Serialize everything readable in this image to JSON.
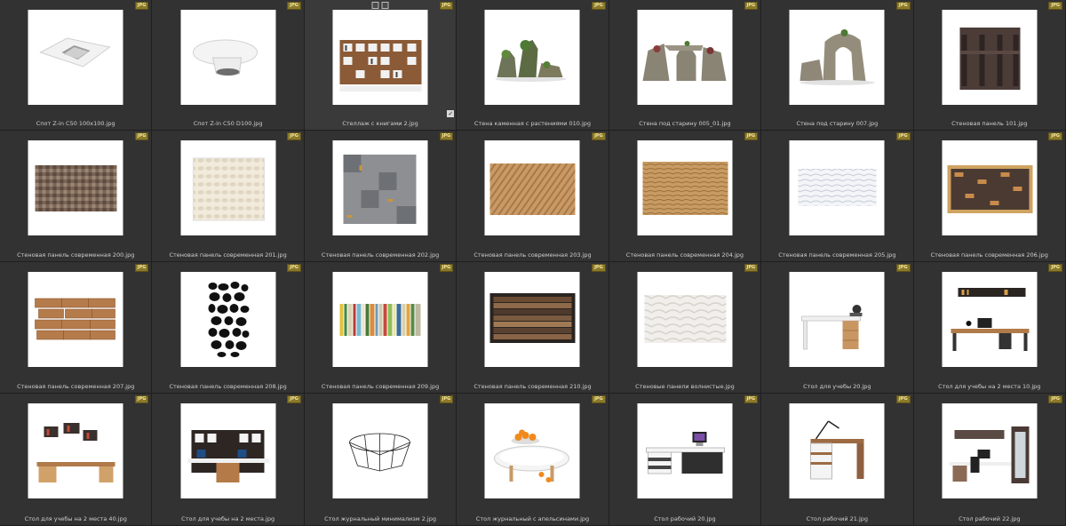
{
  "badge": "JPG",
  "items": [
    {
      "label": "Спот Z-in C50 100x100.jpg",
      "icon": "square-ceiling-spot-thumbnail"
    },
    {
      "label": "Спот Z-in C50 D100.jpg",
      "icon": "round-ceiling-spot-thumbnail"
    },
    {
      "label": "Стеллаж с книгами 2.jpg",
      "icon": "bookshelf-thumbnail"
    },
    {
      "label": "Стена каменная с растениями 010.jpg",
      "icon": "stone-wall-plants-thumbnail"
    },
    {
      "label": "Стена под старину 005_01.jpg",
      "icon": "ruin-arch-thumbnail"
    },
    {
      "label": "Стена под старину 007.jpg",
      "icon": "ruin-arch-thumbnail"
    },
    {
      "label": "Стеновая панель 101.jpg",
      "icon": "dark-wall-panel-thumbnail"
    },
    {
      "label": "Стеновая панель современная 200.jpg",
      "icon": "mosaic-panel-thumbnail"
    },
    {
      "label": "Стеновая панель современная 201.jpg",
      "icon": "white-relief-panel-thumbnail"
    },
    {
      "label": "Стеновая панель современная 202.jpg",
      "icon": "gray-tile-panel-thumbnail"
    },
    {
      "label": "Стеновая панель современная 203.jpg",
      "icon": "wood-diagonal-panel-thumbnail"
    },
    {
      "label": "Стеновая панель современная 204.jpg",
      "icon": "wood-wave-panel-thumbnail"
    },
    {
      "label": "Стеновая панель современная 205.jpg",
      "icon": "white-wave-panel-thumbnail"
    },
    {
      "label": "Стеновая панель современная 206.jpg",
      "icon": "brick-block-panel-thumbnail"
    },
    {
      "label": "Стеновая панель современная 207.jpg",
      "icon": "brick-panel-thumbnail"
    },
    {
      "label": "Стеновая панель современная 208.jpg",
      "icon": "pebble-panel-thumbnail"
    },
    {
      "label": "Стеновая панель современная 209.jpg",
      "icon": "color-stripe-panel-thumbnail"
    },
    {
      "label": "Стеновая панель современная 210.jpg",
      "icon": "wood-plank-panel-thumbnail"
    },
    {
      "label": "Стеновые панели волнистые.jpg",
      "icon": "wavy-panel-thumbnail"
    },
    {
      "label": "Стол для учебы 20.jpg",
      "icon": "desk-thumbnail"
    },
    {
      "label": "Стол для учебы на 2 места 10.jpg",
      "icon": "double-desk-thumbnail"
    },
    {
      "label": "Стол для учебы на 2 места 40.jpg",
      "icon": "double-desk-shelves-thumbnail"
    },
    {
      "label": "Стол для учебы на 2 места.jpg",
      "icon": "workstation-thumbnail"
    },
    {
      "label": "Стол журнальный минимализм 2.jpg",
      "icon": "wire-coffee-table-thumbnail"
    },
    {
      "label": "Стол журнальный с апельсинами.jpg",
      "icon": "oval-coffee-table-thumbnail"
    },
    {
      "label": "Стол рабочий 20.jpg",
      "icon": "office-desk-thumbnail"
    },
    {
      "label": "Стол рабочий 21.jpg",
      "icon": "wood-desk-lamp-thumbnail"
    },
    {
      "label": "Стол рабочий 22.jpg",
      "icon": "office-room-thumbnail"
    }
  ]
}
